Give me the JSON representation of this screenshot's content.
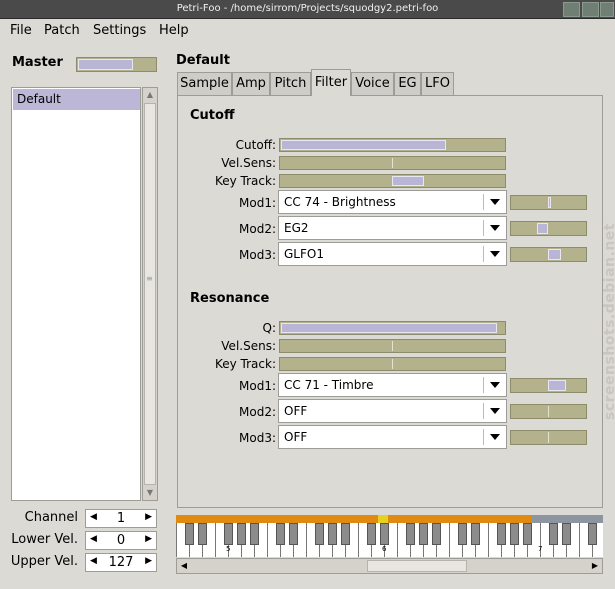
{
  "window": {
    "title": "Petri-Foo - /home/sirrom/Projects/squodgy2.petri-foo"
  },
  "menu": [
    "File",
    "Patch",
    "Settings",
    "Help"
  ],
  "master": {
    "label": "Master",
    "level": 0.72
  },
  "patches": [
    "Default"
  ],
  "spins": [
    {
      "label": "Channel",
      "value": "1"
    },
    {
      "label": "Lower Vel.",
      "value": "0"
    },
    {
      "label": "Upper Vel.",
      "value": "127"
    }
  ],
  "patch_title": "Default",
  "tabs": [
    "Sample",
    "Amp",
    "Pitch",
    "Filter",
    "Voice",
    "EG",
    "LFO"
  ],
  "active_tab": "Filter",
  "cutoff": {
    "heading": "Cutoff",
    "cutoff_label": "Cutoff:",
    "cutoff_value": 0.74,
    "velsens_label": "Vel.Sens:",
    "keytrack_label": "Key Track:",
    "keytrack_value": 0.29,
    "mods": [
      {
        "label": "Mod1:",
        "source": "CC 74 - Brightness",
        "amount": 0.05
      },
      {
        "label": "Mod2:",
        "source": "EG2",
        "amount": -0.3
      },
      {
        "label": "Mod3:",
        "source": "GLFO1",
        "amount": 0.35
      }
    ]
  },
  "resonance": {
    "heading": "Resonance",
    "q_label": "Q:",
    "q_value": 0.97,
    "velsens_label": "Vel.Sens:",
    "keytrack_label": "Key Track:",
    "mods": [
      {
        "label": "Mod1:",
        "source": "CC 71 - Timbre",
        "amount": 0.5
      },
      {
        "label": "Mod2:",
        "source": "OFF",
        "amount": 0
      },
      {
        "label": "Mod3:",
        "source": "OFF",
        "amount": 0
      }
    ]
  },
  "keyboard": {
    "octave_labels": [
      "5",
      "6",
      "7"
    ]
  },
  "watermark": "screenshots.debian.net"
}
